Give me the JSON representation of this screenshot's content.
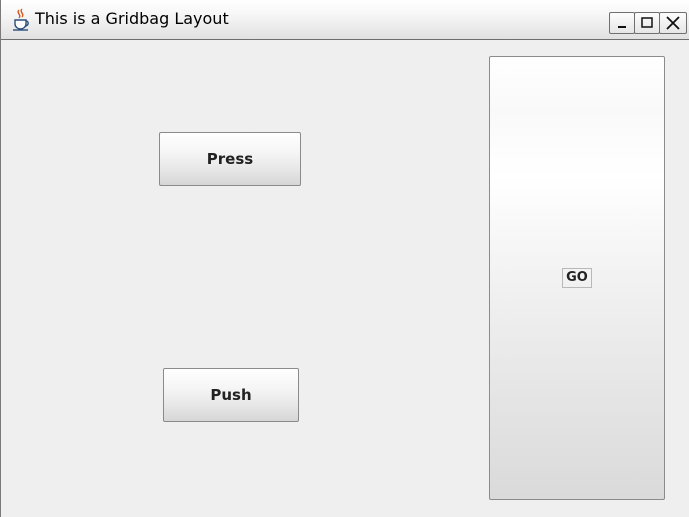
{
  "window": {
    "title": "This is a Gridbag Layout",
    "title_icon": "java-cup-icon",
    "controls": {
      "minimize_icon": "minimize-icon",
      "maximize_icon": "maximize-icon",
      "close_icon": "close-icon"
    }
  },
  "buttons": {
    "press_label": "Press",
    "push_label": "Push",
    "go_label": "GO"
  }
}
